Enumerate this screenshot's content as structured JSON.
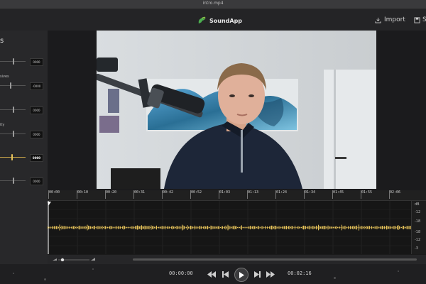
{
  "window": {
    "title": "intro.mp4"
  },
  "app": {
    "name": "SoundApp",
    "accent": "#e6c35a"
  },
  "toolbar": {
    "import_label": "Import",
    "save_label": "S"
  },
  "sidebar": {
    "title": "s",
    "rows": [
      {
        "label": "",
        "value": "0000",
        "level": 0.5,
        "active": false
      },
      {
        "label": "sives",
        "value": "-0000",
        "level": 0.4,
        "active": false
      },
      {
        "label": "",
        "value": "0000",
        "level": 0.5,
        "active": false
      },
      {
        "label": "ity",
        "value": "0000",
        "level": 0.5,
        "active": false
      },
      {
        "label": "",
        "value": "0000",
        "level": 0.45,
        "active": true
      },
      {
        "label": "",
        "value": "0000",
        "level": 0.5,
        "active": false
      }
    ]
  },
  "timeline": {
    "ticks": [
      "00:00",
      "00:10",
      "00:20",
      "00:31",
      "00:42",
      "00:52",
      "01:03",
      "01:13",
      "01:24",
      "01:34",
      "01:45",
      "01:55",
      "02:06"
    ],
    "db_labels": [
      "dB",
      "-12",
      "-18",
      "-18",
      "-12",
      "-3"
    ],
    "wave_color": "#e6c35a"
  },
  "transport": {
    "current_time": "00:00:00",
    "total_time": "00:02:16"
  }
}
